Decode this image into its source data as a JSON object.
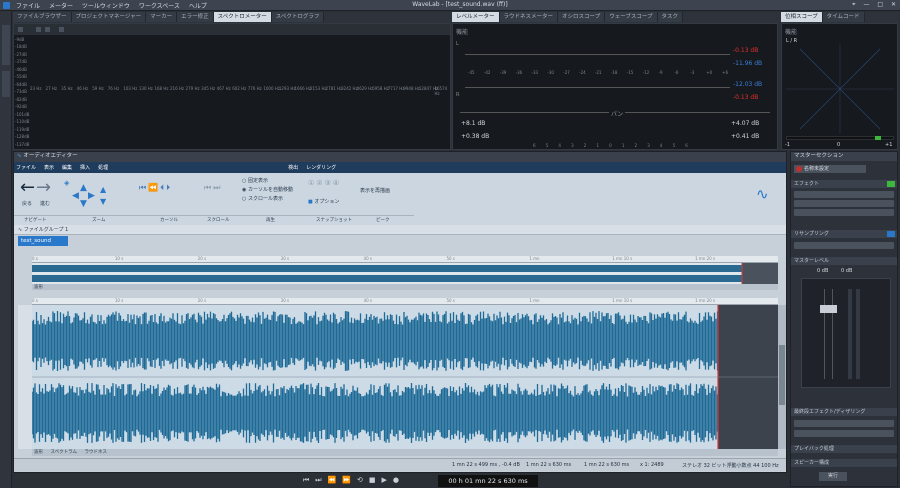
{
  "app": {
    "title": "WaveLab - [test_sound.wav (ff)]"
  },
  "menu": [
    "ファイル",
    "メーター",
    "ツールウィンドウ",
    "ワークスペース",
    "ヘルプ"
  ],
  "top_tabs": [
    "ファイルブラウザー",
    "プロジェクトマネージャー",
    "マーカー",
    "エラー修正",
    "スペクトロメーター",
    "スペクトログラフ"
  ],
  "meter_tabs": [
    "レベルメーター",
    "ラウドネスメーター",
    "オシロスコープ",
    "ウェーブスコープ",
    "タスク"
  ],
  "scope_tabs": [
    "位相スコープ",
    "タイムコード"
  ],
  "function_label": "機能",
  "spectro": {
    "db": [
      "-9dB",
      "-18dB",
      "-27dB",
      "-37dB",
      "-46dB",
      "-55dB",
      "-64dB",
      "-73dB",
      "-82dB",
      "-92dB",
      "-101dB",
      "-110dB",
      "-119dB",
      "-128dB",
      "-137dB"
    ],
    "freqs": [
      "23 Hz",
      "27 Hz",
      "35 Hz",
      "46 Hz",
      "59 Hz",
      "76 Hz",
      "103 Hz",
      "130 Hz",
      "168 Hz",
      "216 Hz",
      "279 Hz",
      "345 Hz",
      "467 Hz",
      "602 Hz",
      "776 Hz",
      "1000 Hz",
      "1293 Hz",
      "1666 Hz",
      "2153 Hz",
      "2781 Hz",
      "3242 Hz",
      "4629 Hz",
      "5958 Hz",
      "7717 Hz",
      "9948 Hz",
      "12847 Hz",
      "16574 Hz"
    ]
  },
  "level": {
    "scale": [
      "-45",
      "-42",
      "-39",
      "-36",
      "-33",
      "-30",
      "-27",
      "-24",
      "-21",
      "-18",
      "-15",
      "-12",
      "-9",
      "-6",
      "-3",
      "+0",
      "+6"
    ],
    "l_peak": "-0.13 dB",
    "l_rms": "-11.96 dB",
    "r_peak": "-12.03 dB",
    "r_rms": "-0.13 dB",
    "pan_label": "パン",
    "l_sum": "+8.1 dB",
    "r_sum": "+4.07 dB",
    "l_sum2": "+0.38 dB",
    "r_sum2": "+0.41 dB",
    "bottom_scale": [
      "6",
      "5",
      "4",
      "3",
      "2",
      "1",
      "0",
      "1",
      "2",
      "3",
      "4",
      "5",
      "6"
    ],
    "ch_l": "L",
    "ch_r": "R"
  },
  "phase": {
    "label": "L / R",
    "left": "-1",
    "center": "0",
    "right": "+1"
  },
  "editor": {
    "title": "オーディオエディター",
    "tabs": [
      "ファイル",
      "表示",
      "編集",
      "挿入",
      "処理",
      "検出",
      "レンダリング"
    ],
    "groups": [
      "ナビゲート",
      "ズーム",
      "カーソル",
      "スクロール",
      "再生",
      "スナップショット",
      "ピーク"
    ],
    "nav_back": "戻る",
    "nav_fwd": "進む",
    "radio": [
      "固定表示",
      "カーソルを自動移動",
      "スクロール表示"
    ],
    "option": "オプション",
    "redraw": "表示を再描画",
    "file_group": "ファイルグループ 1",
    "file_tab": "test_sound",
    "overview_times": [
      "0 s",
      "10 s",
      "20 s",
      "30 s",
      "40 s",
      "50 s",
      "1 mn",
      "1 mn 10 s",
      "1 mn 20 s"
    ],
    "main_times": [
      "0 s",
      "10 s",
      "20 s",
      "30 s",
      "40 s",
      "50 s",
      "1 mn",
      "1 mn 10 s",
      "1 mn 20 s"
    ],
    "bottom_tabs": [
      "波形",
      "スペクトラム",
      "ラウドネス"
    ],
    "status": {
      "cursor": "1 mn 22 s 499 ms , -0.4 dB",
      "pos": "1 mn 22 s 630 ms",
      "sel": "1 mn 22 s 630 ms",
      "zoom": "x 1: 2489",
      "format": "ステレオ 32 ビット浮動小数点 44 100 Hz"
    }
  },
  "transport": {
    "time": "00 h 01 mn 22 s 630 ms"
  },
  "master": {
    "title": "マスターセクション",
    "preset": "名称未設定",
    "effects": "エフェクト",
    "resample": "リサンプリング",
    "level": "マスターレベル",
    "db_l": "0 dB",
    "db_r": "0 dB",
    "final": "最終段エフェクト/ディザリング",
    "playback": "プレイバック処理",
    "speaker": "スピーカー構成",
    "render": "実行"
  },
  "colors": {
    "accent": "#2a78c9",
    "wave": "#1d6a96",
    "bg": "#2b2f36"
  }
}
